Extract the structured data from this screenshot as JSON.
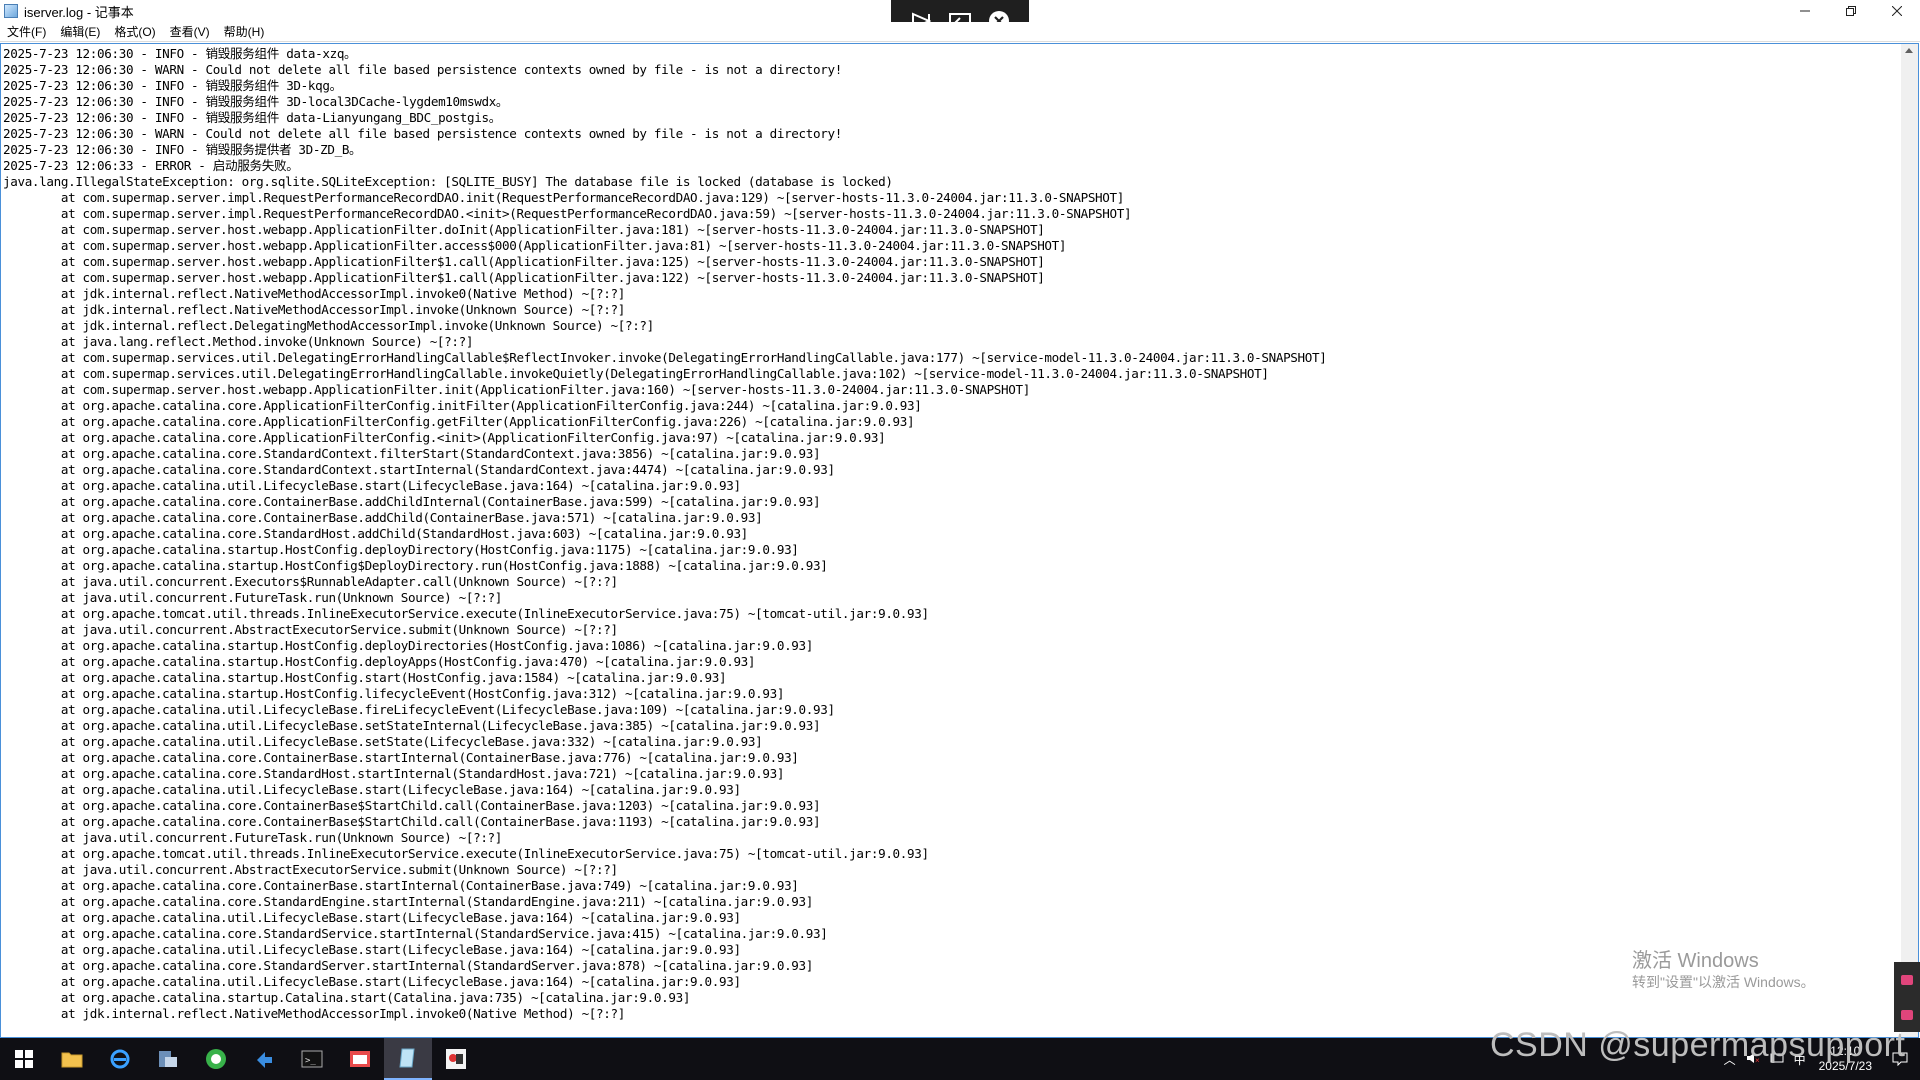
{
  "window": {
    "title": "iserver.log - 记事本"
  },
  "menu": [
    "文件(F)",
    "编辑(E)",
    "格式(O)",
    "查看(V)",
    "帮助(H)"
  ],
  "log_lines": [
    "2025-7-23 12:06:30 - INFO - 销毁服务组件 data-xzq。",
    "2025-7-23 12:06:30 - WARN - Could not delete all file based persistence contexts owned by file - is not a directory!",
    "2025-7-23 12:06:30 - INFO - 销毁服务组件 3D-kqg。",
    "2025-7-23 12:06:30 - INFO - 销毁服务组件 3D-local3DCache-lygdem10mswdx。",
    "2025-7-23 12:06:30 - INFO - 销毁服务组件 data-Lianyungang_BDC_postgis。",
    "2025-7-23 12:06:30 - WARN - Could not delete all file based persistence contexts owned by file - is not a directory!",
    "2025-7-23 12:06:30 - INFO - 销毁服务提供者 3D-ZD_B。",
    "2025-7-23 12:06:33 - ERROR - 启动服务失败。",
    "java.lang.IllegalStateException: org.sqlite.SQLiteException: [SQLITE_BUSY] The database file is locked (database is locked)",
    "\tat com.supermap.server.impl.RequestPerformanceRecordDAO.init(RequestPerformanceRecordDAO.java:129) ~[server-hosts-11.3.0-24004.jar:11.3.0-SNAPSHOT]",
    "\tat com.supermap.server.impl.RequestPerformanceRecordDAO.<init>(RequestPerformanceRecordDAO.java:59) ~[server-hosts-11.3.0-24004.jar:11.3.0-SNAPSHOT]",
    "\tat com.supermap.server.host.webapp.ApplicationFilter.doInit(ApplicationFilter.java:181) ~[server-hosts-11.3.0-24004.jar:11.3.0-SNAPSHOT]",
    "\tat com.supermap.server.host.webapp.ApplicationFilter.access$000(ApplicationFilter.java:81) ~[server-hosts-11.3.0-24004.jar:11.3.0-SNAPSHOT]",
    "\tat com.supermap.server.host.webapp.ApplicationFilter$1.call(ApplicationFilter.java:125) ~[server-hosts-11.3.0-24004.jar:11.3.0-SNAPSHOT]",
    "\tat com.supermap.server.host.webapp.ApplicationFilter$1.call(ApplicationFilter.java:122) ~[server-hosts-11.3.0-24004.jar:11.3.0-SNAPSHOT]",
    "\tat jdk.internal.reflect.NativeMethodAccessorImpl.invoke0(Native Method) ~[?:?]",
    "\tat jdk.internal.reflect.NativeMethodAccessorImpl.invoke(Unknown Source) ~[?:?]",
    "\tat jdk.internal.reflect.DelegatingMethodAccessorImpl.invoke(Unknown Source) ~[?:?]",
    "\tat java.lang.reflect.Method.invoke(Unknown Source) ~[?:?]",
    "\tat com.supermap.services.util.DelegatingErrorHandlingCallable$ReflectInvoker.invoke(DelegatingErrorHandlingCallable.java:177) ~[service-model-11.3.0-24004.jar:11.3.0-SNAPSHOT]",
    "\tat com.supermap.services.util.DelegatingErrorHandlingCallable.invokeQuietly(DelegatingErrorHandlingCallable.java:102) ~[service-model-11.3.0-24004.jar:11.3.0-SNAPSHOT]",
    "\tat com.supermap.server.host.webapp.ApplicationFilter.init(ApplicationFilter.java:160) ~[server-hosts-11.3.0-24004.jar:11.3.0-SNAPSHOT]",
    "\tat org.apache.catalina.core.ApplicationFilterConfig.initFilter(ApplicationFilterConfig.java:244) ~[catalina.jar:9.0.93]",
    "\tat org.apache.catalina.core.ApplicationFilterConfig.getFilter(ApplicationFilterConfig.java:226) ~[catalina.jar:9.0.93]",
    "\tat org.apache.catalina.core.ApplicationFilterConfig.<init>(ApplicationFilterConfig.java:97) ~[catalina.jar:9.0.93]",
    "\tat org.apache.catalina.core.StandardContext.filterStart(StandardContext.java:3856) ~[catalina.jar:9.0.93]",
    "\tat org.apache.catalina.core.StandardContext.startInternal(StandardContext.java:4474) ~[catalina.jar:9.0.93]",
    "\tat org.apache.catalina.util.LifecycleBase.start(LifecycleBase.java:164) ~[catalina.jar:9.0.93]",
    "\tat org.apache.catalina.core.ContainerBase.addChildInternal(ContainerBase.java:599) ~[catalina.jar:9.0.93]",
    "\tat org.apache.catalina.core.ContainerBase.addChild(ContainerBase.java:571) ~[catalina.jar:9.0.93]",
    "\tat org.apache.catalina.core.StandardHost.addChild(StandardHost.java:603) ~[catalina.jar:9.0.93]",
    "\tat org.apache.catalina.startup.HostConfig.deployDirectory(HostConfig.java:1175) ~[catalina.jar:9.0.93]",
    "\tat org.apache.catalina.startup.HostConfig$DeployDirectory.run(HostConfig.java:1888) ~[catalina.jar:9.0.93]",
    "\tat java.util.concurrent.Executors$RunnableAdapter.call(Unknown Source) ~[?:?]",
    "\tat java.util.concurrent.FutureTask.run(Unknown Source) ~[?:?]",
    "\tat org.apache.tomcat.util.threads.InlineExecutorService.execute(InlineExecutorService.java:75) ~[tomcat-util.jar:9.0.93]",
    "\tat java.util.concurrent.AbstractExecutorService.submit(Unknown Source) ~[?:?]",
    "\tat org.apache.catalina.startup.HostConfig.deployDirectories(HostConfig.java:1086) ~[catalina.jar:9.0.93]",
    "\tat org.apache.catalina.startup.HostConfig.deployApps(HostConfig.java:470) ~[catalina.jar:9.0.93]",
    "\tat org.apache.catalina.startup.HostConfig.start(HostConfig.java:1584) ~[catalina.jar:9.0.93]",
    "\tat org.apache.catalina.startup.HostConfig.lifecycleEvent(HostConfig.java:312) ~[catalina.jar:9.0.93]",
    "\tat org.apache.catalina.util.LifecycleBase.fireLifecycleEvent(LifecycleBase.java:109) ~[catalina.jar:9.0.93]",
    "\tat org.apache.catalina.util.LifecycleBase.setStateInternal(LifecycleBase.java:385) ~[catalina.jar:9.0.93]",
    "\tat org.apache.catalina.util.LifecycleBase.setState(LifecycleBase.java:332) ~[catalina.jar:9.0.93]",
    "\tat org.apache.catalina.core.ContainerBase.startInternal(ContainerBase.java:776) ~[catalina.jar:9.0.93]",
    "\tat org.apache.catalina.core.StandardHost.startInternal(StandardHost.java:721) ~[catalina.jar:9.0.93]",
    "\tat org.apache.catalina.util.LifecycleBase.start(LifecycleBase.java:164) ~[catalina.jar:9.0.93]",
    "\tat org.apache.catalina.core.ContainerBase$StartChild.call(ContainerBase.java:1203) ~[catalina.jar:9.0.93]",
    "\tat org.apache.catalina.core.ContainerBase$StartChild.call(ContainerBase.java:1193) ~[catalina.jar:9.0.93]",
    "\tat java.util.concurrent.FutureTask.run(Unknown Source) ~[?:?]",
    "\tat org.apache.tomcat.util.threads.InlineExecutorService.execute(InlineExecutorService.java:75) ~[tomcat-util.jar:9.0.93]",
    "\tat java.util.concurrent.AbstractExecutorService.submit(Unknown Source) ~[?:?]",
    "\tat org.apache.catalina.core.ContainerBase.startInternal(ContainerBase.java:749) ~[catalina.jar:9.0.93]",
    "\tat org.apache.catalina.core.StandardEngine.startInternal(StandardEngine.java:211) ~[catalina.jar:9.0.93]",
    "\tat org.apache.catalina.util.LifecycleBase.start(LifecycleBase.java:164) ~[catalina.jar:9.0.93]",
    "\tat org.apache.catalina.core.StandardService.startInternal(StandardService.java:415) ~[catalina.jar:9.0.93]",
    "\tat org.apache.catalina.util.LifecycleBase.start(LifecycleBase.java:164) ~[catalina.jar:9.0.93]",
    "\tat org.apache.catalina.core.StandardServer.startInternal(StandardServer.java:878) ~[catalina.jar:9.0.93]",
    "\tat org.apache.catalina.util.LifecycleBase.start(LifecycleBase.java:164) ~[catalina.jar:9.0.93]",
    "\tat org.apache.catalina.startup.Catalina.start(Catalina.java:735) ~[catalina.jar:9.0.93]",
    "\tat jdk.internal.reflect.NativeMethodAccessorImpl.invoke0(Native Method) ~[?:?]"
  ],
  "watermark": {
    "activate_title": "激活 Windows",
    "activate_sub": "转到\"设置\"以激活 Windows。",
    "csdn": "CSDN @supermapsupport"
  },
  "taskbar": {
    "items": [
      "windows-start",
      "file-explorer",
      "internet-explorer",
      "server-manager",
      "green-app",
      "blue-arrow-app",
      "command-prompt",
      "red-window-app",
      "notepad",
      "paint-app"
    ],
    "active_item": "notepad",
    "clock_time": "12:10",
    "clock_date": "2025/7/23",
    "ime": "中"
  },
  "colors": {
    "editor_border": "#4a90d9",
    "taskbar_bg": "#0f0f14",
    "remote_toolbar_bg": "#1f1f1f"
  }
}
